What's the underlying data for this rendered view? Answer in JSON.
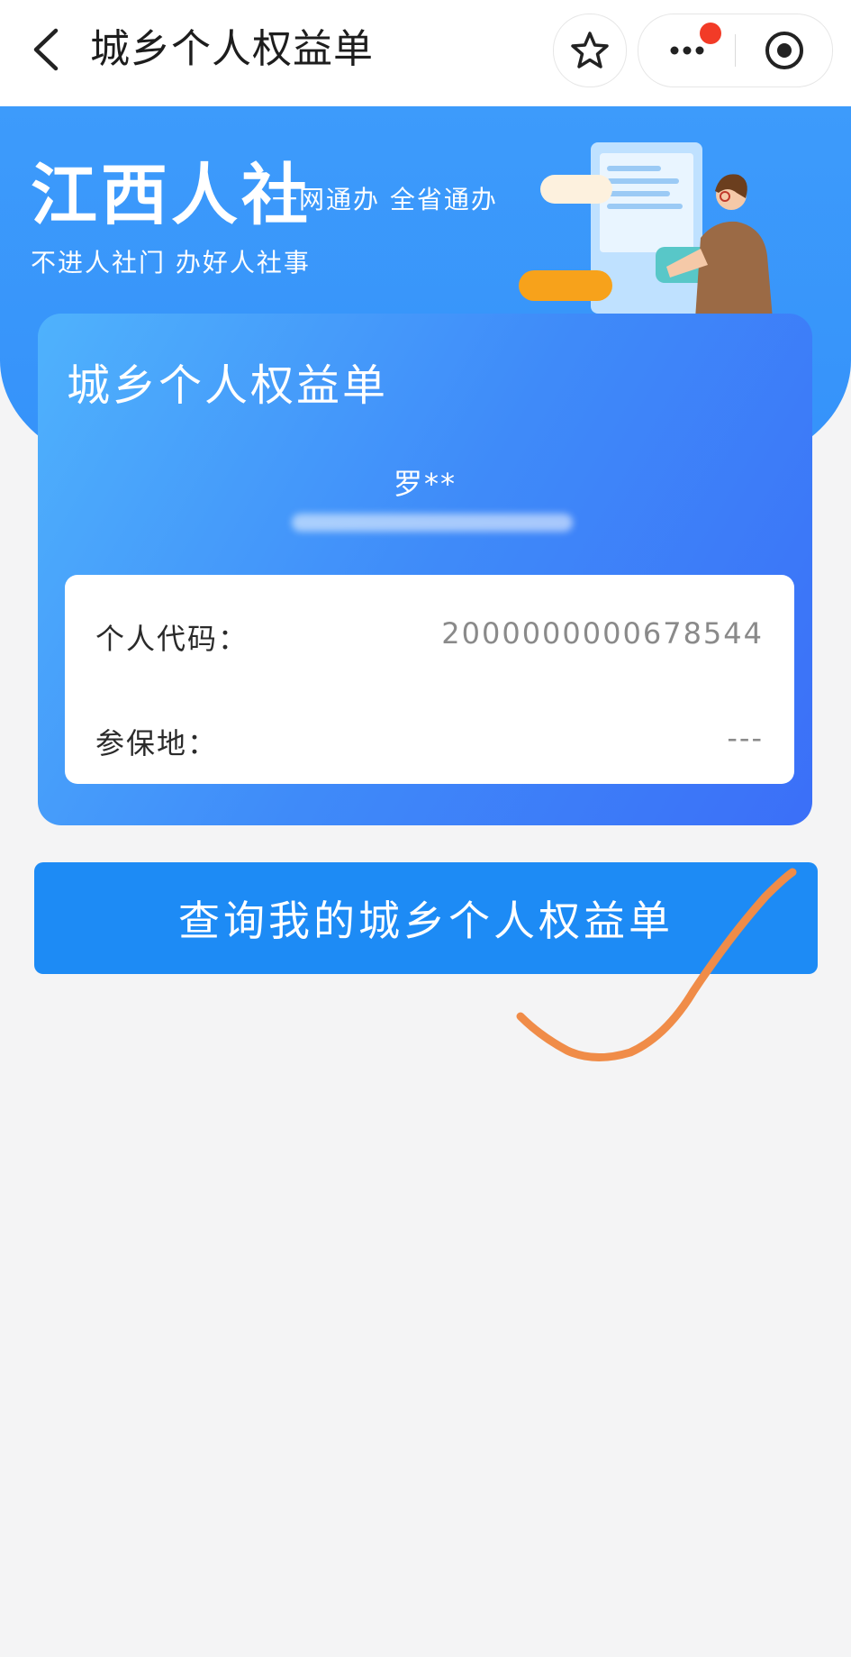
{
  "nav": {
    "title": "城乡个人权益单"
  },
  "banner": {
    "logo_text": "江西人社",
    "slogan_primary": "一网通办 全省通办",
    "slogan_secondary": "不进人社门 办好人社事"
  },
  "card": {
    "title": "城乡个人权益单",
    "name": "罗**",
    "fields": [
      {
        "label": "个人代码：",
        "value": "2000000000678544"
      },
      {
        "label": "参保地：",
        "value": "---"
      }
    ]
  },
  "actions": {
    "query_label": "查询我的城乡个人权益单"
  },
  "colors": {
    "primary": "#1d8bf5",
    "banner": "#3d9bfb",
    "badge": "#f23b27",
    "annotation": "#f08c48"
  }
}
